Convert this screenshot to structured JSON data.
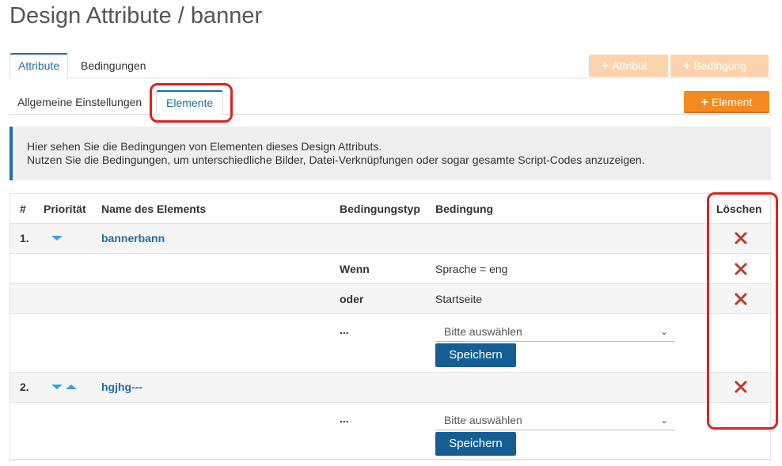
{
  "page": {
    "title": "Design Attribute / banner"
  },
  "tabs": [
    {
      "label": "Attribute",
      "active": true
    },
    {
      "label": "Bedingungen",
      "active": false
    }
  ],
  "toolbar": {
    "attribut_label": "Attribut",
    "bedingung_label": "Bedingung",
    "element_label": "Element",
    "plus": "+"
  },
  "subtabs": [
    {
      "label": "Allgemeine Einstellungen",
      "active": false
    },
    {
      "label": "Elemente",
      "active": true
    }
  ],
  "info": {
    "line1": "Hier sehen Sie die Bedingungen von Elementen dieses Design Attributs.",
    "line2": "Nutzen Sie die Bedingungen, um unterschiedliche Bilder, Datei-Verknüpfungen oder sogar gesamte Script-Codes anzuzeigen."
  },
  "table": {
    "headers": {
      "num": "#",
      "priority": "Priorität",
      "name": "Name des Elements",
      "type": "Bedingungstyp",
      "condition": "Bedingung",
      "delete": "Löschen"
    },
    "elements": [
      {
        "num": "1.",
        "name": "bannerbann",
        "conditions": [
          {
            "type": "Wenn",
            "value": "Sprache = eng"
          },
          {
            "type": "oder",
            "value": "Startseite"
          }
        ],
        "new_type": "...",
        "select_placeholder": "Bitte auswählen",
        "save_label": "Speichern"
      },
      {
        "num": "2.",
        "name": "hgjhg---",
        "conditions": [],
        "new_type": "...",
        "select_placeholder": "Bitte auswählen",
        "save_label": "Speichern"
      }
    ]
  },
  "colors": {
    "primary": "#1e6fa8",
    "orange": "#f58a1f",
    "orange_disabled": "#fbd3ad",
    "save_button": "#135f95",
    "delete_icon": "#c0392b",
    "highlight": "#e02020"
  }
}
